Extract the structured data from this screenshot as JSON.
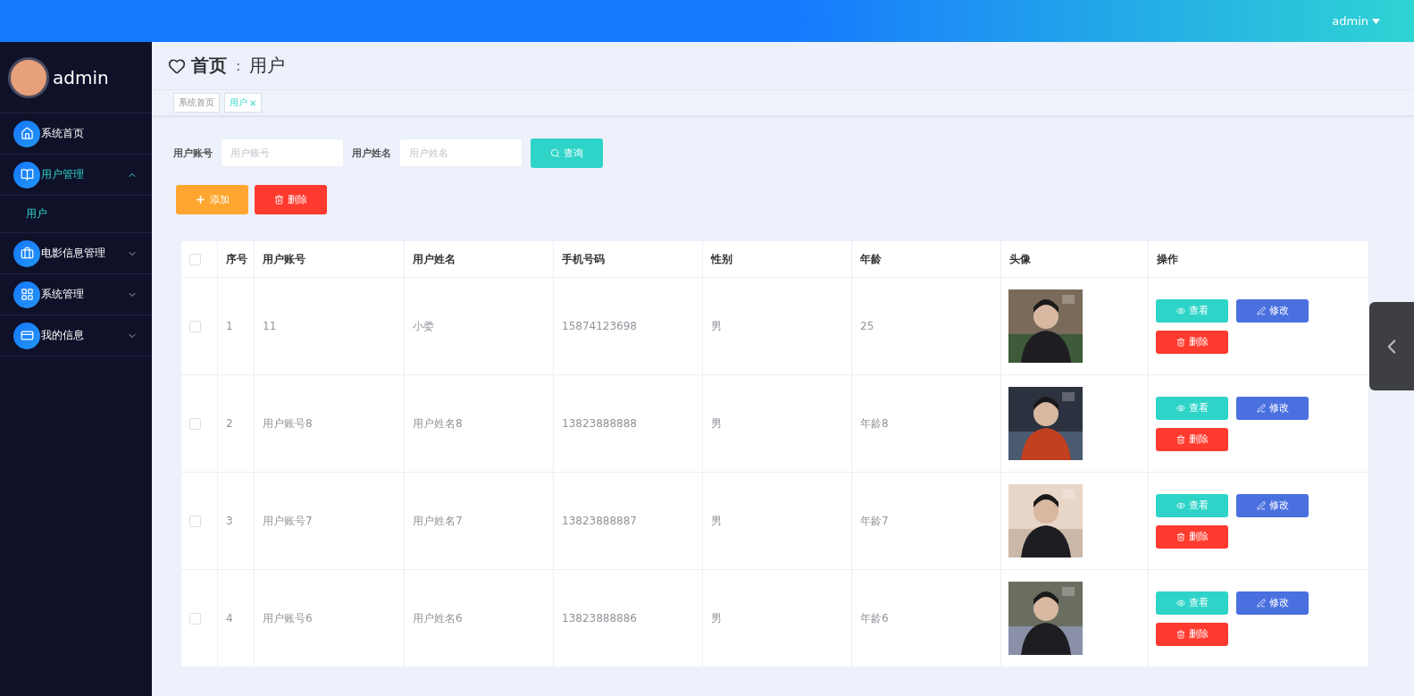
{
  "topbar": {
    "user": "admin"
  },
  "sidebar": {
    "user": "admin",
    "items": [
      {
        "label": "系统首页",
        "selected": false
      },
      {
        "label": "用户管理",
        "expanded": true,
        "selected": true,
        "children": [
          {
            "label": "用户",
            "selected": true
          }
        ]
      },
      {
        "label": "电影信息管理",
        "expanded": false,
        "selected": false
      },
      {
        "label": "系统管理",
        "expanded": false,
        "selected": false
      },
      {
        "label": "我的信息",
        "expanded": false,
        "selected": false
      }
    ]
  },
  "breadcrumb": {
    "home": "首页",
    "separator": ":",
    "current": "用户"
  },
  "tabs": [
    {
      "label": "系统首页",
      "selected": false
    },
    {
      "label": "用户",
      "selected": true,
      "close": "×"
    }
  ],
  "filters": [
    {
      "label": "用户账号",
      "placeholder": "用户账号"
    },
    {
      "label": "用户姓名",
      "placeholder": "用户姓名"
    }
  ],
  "search_button": "查询",
  "actions": [
    {
      "kind": "add",
      "label": "添加"
    },
    {
      "kind": "delete",
      "label": "删除"
    }
  ],
  "table": {
    "all_checked": false,
    "columns": [
      "序号",
      "用户账号",
      "用户姓名",
      "手机号码",
      "性别",
      "年龄",
      "头像",
      "操作"
    ],
    "rows": [
      {
        "checked": false,
        "cells": [
          "1",
          "11",
          "小娄",
          "15874123698",
          "男",
          "25"
        ],
        "avatar": {
          "kind": "picture"
        },
        "buttons": [
          "查看",
          "修改",
          "删除"
        ]
      },
      {
        "checked": false,
        "cells": [
          "2",
          "用户账号8",
          "用户姓名8",
          "13823888888",
          "男",
          "年龄8"
        ],
        "avatar": {
          "kind": "picture"
        },
        "buttons": [
          "查看",
          "修改",
          "删除"
        ]
      },
      {
        "checked": false,
        "cells": [
          "3",
          "用户账号7",
          "用户姓名7",
          "13823888887",
          "男",
          "年龄7"
        ],
        "avatar": {
          "kind": "picture"
        },
        "buttons": [
          "查看",
          "修改",
          "删除"
        ]
      },
      {
        "checked": false,
        "cells": [
          "4",
          "用户账号6",
          "用户姓名6",
          "13823888886",
          "男",
          "年龄6"
        ],
        "avatar": {
          "kind": "picture"
        },
        "buttons": [
          "查看",
          "修改",
          "删除"
        ]
      }
    ]
  }
}
